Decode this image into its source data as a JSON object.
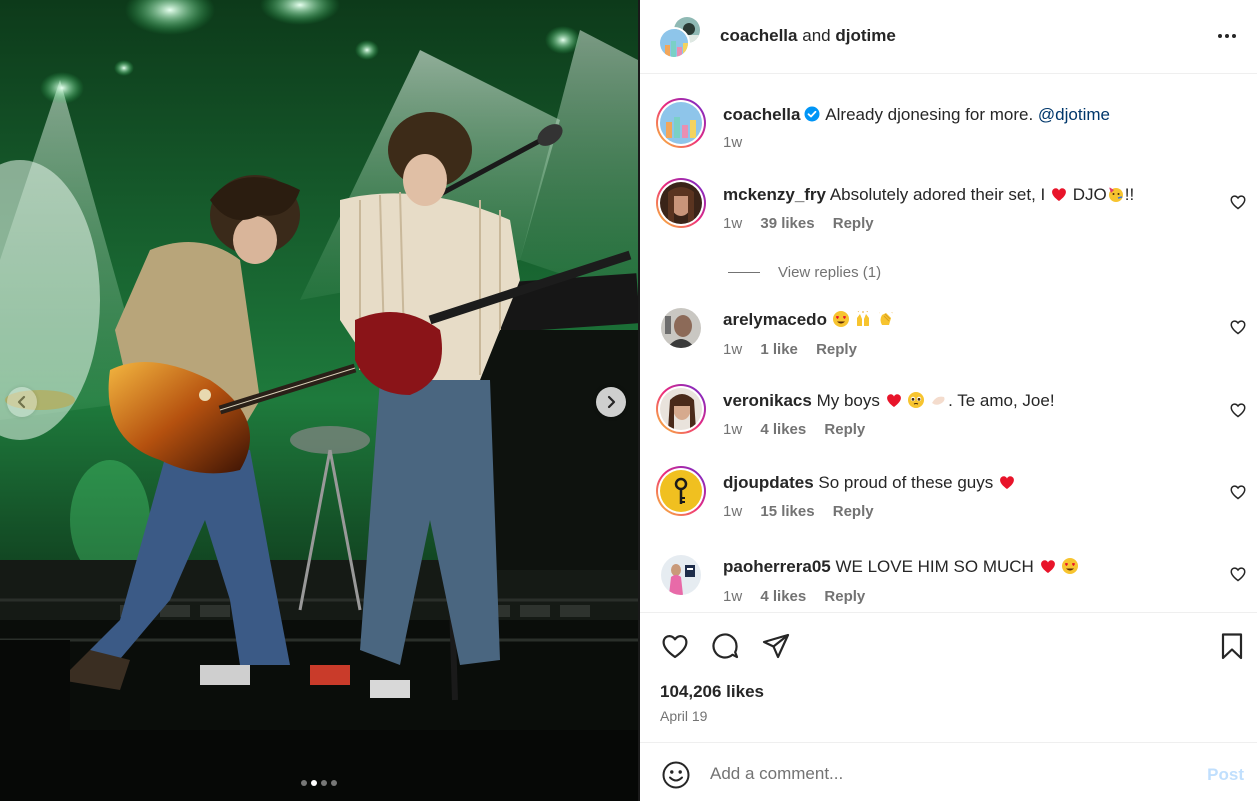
{
  "header": {
    "author": "coachella",
    "connector": "and",
    "collaborator": "djotime"
  },
  "caption": {
    "username": "coachella",
    "text": "Already djonesing for more.",
    "mention": "@djotime",
    "time": "1w"
  },
  "comments": [
    {
      "username": "mckenzy_fry",
      "text_before": "Absolutely adored their set, I",
      "text_mid": "DJO",
      "text_after": "!!",
      "time": "1w",
      "likes": "39 likes",
      "reply": "Reply",
      "view_replies": "View replies (1)"
    },
    {
      "username": "arelymacedo",
      "text_before": "",
      "time": "1w",
      "likes": "1 like",
      "reply": "Reply"
    },
    {
      "username": "veronikacs",
      "text_before": "My boys",
      "text_after": ". Te amo, Joe!",
      "time": "1w",
      "likes": "4 likes",
      "reply": "Reply"
    },
    {
      "username": "djoupdates",
      "text_before": "So proud of these guys",
      "time": "1w",
      "likes": "15 likes",
      "reply": "Reply"
    },
    {
      "username": "paoherrera05",
      "text_before": "WE LOVE HIM SO MUCH",
      "time": "1w",
      "likes": "4 likes",
      "reply": "Reply"
    }
  ],
  "post": {
    "likes": "104,206 likes",
    "date": "April 19"
  },
  "composer": {
    "placeholder": "Add a comment...",
    "post_label": "Post"
  },
  "carousel": {
    "count": 4,
    "active_index": 1
  },
  "icons": {
    "like": "heart-icon",
    "comment": "comment-icon",
    "share": "share-icon",
    "save": "bookmark-icon",
    "more": "more-icon",
    "emoji": "emoji-icon"
  },
  "colors": {
    "accent": "#0095f6",
    "post_disabled": "#c0dffd",
    "mention": "#00376b",
    "heart": "#ff3040"
  }
}
